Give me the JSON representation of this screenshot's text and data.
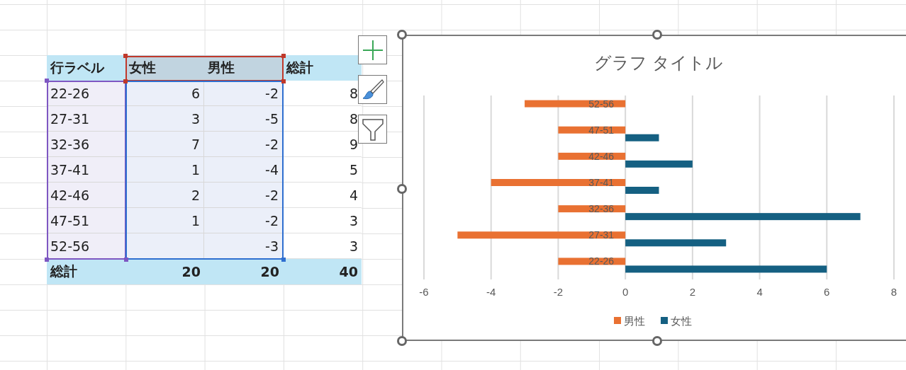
{
  "pivot_table": {
    "header": {
      "row_label": "行ラベル",
      "columns": [
        "女性",
        "男性"
      ],
      "total": "総計"
    },
    "rows": [
      {
        "label": "22-26",
        "female": "6",
        "male": "-2",
        "total": "8"
      },
      {
        "label": "27-31",
        "female": "3",
        "male": "-5",
        "total": "8"
      },
      {
        "label": "32-36",
        "female": "7",
        "male": "-2",
        "total": "9"
      },
      {
        "label": "37-41",
        "female": "1",
        "male": "-4",
        "total": "5"
      },
      {
        "label": "42-46",
        "female": "2",
        "male": "-2",
        "total": "4"
      },
      {
        "label": "47-51",
        "female": "1",
        "male": "-2",
        "total": "3"
      },
      {
        "label": "52-56",
        "male": "-3",
        "total": "3"
      }
    ],
    "grand_total": {
      "label": "総計",
      "female": "20",
      "male": "20",
      "total": "40"
    }
  },
  "chart": {
    "chart_data": {
      "type": "bar",
      "orientation": "horizontal",
      "title": "グラフ タイトル",
      "categories": [
        "52-56",
        "47-51",
        "42-46",
        "37-41",
        "32-36",
        "27-31",
        "22-26"
      ],
      "series": [
        {
          "name": "男性",
          "color": "#e97132",
          "values": [
            -3,
            -2,
            -2,
            -4,
            -2,
            -5,
            -2
          ]
        },
        {
          "name": "女性",
          "color": "#156082",
          "values": [
            null,
            1,
            2,
            1,
            7,
            3,
            6
          ]
        }
      ],
      "xlim": [
        -6,
        8
      ],
      "xticks": [
        -6,
        -4,
        -2,
        0,
        2,
        4,
        6,
        8
      ],
      "grid": true,
      "legend": true
    }
  }
}
